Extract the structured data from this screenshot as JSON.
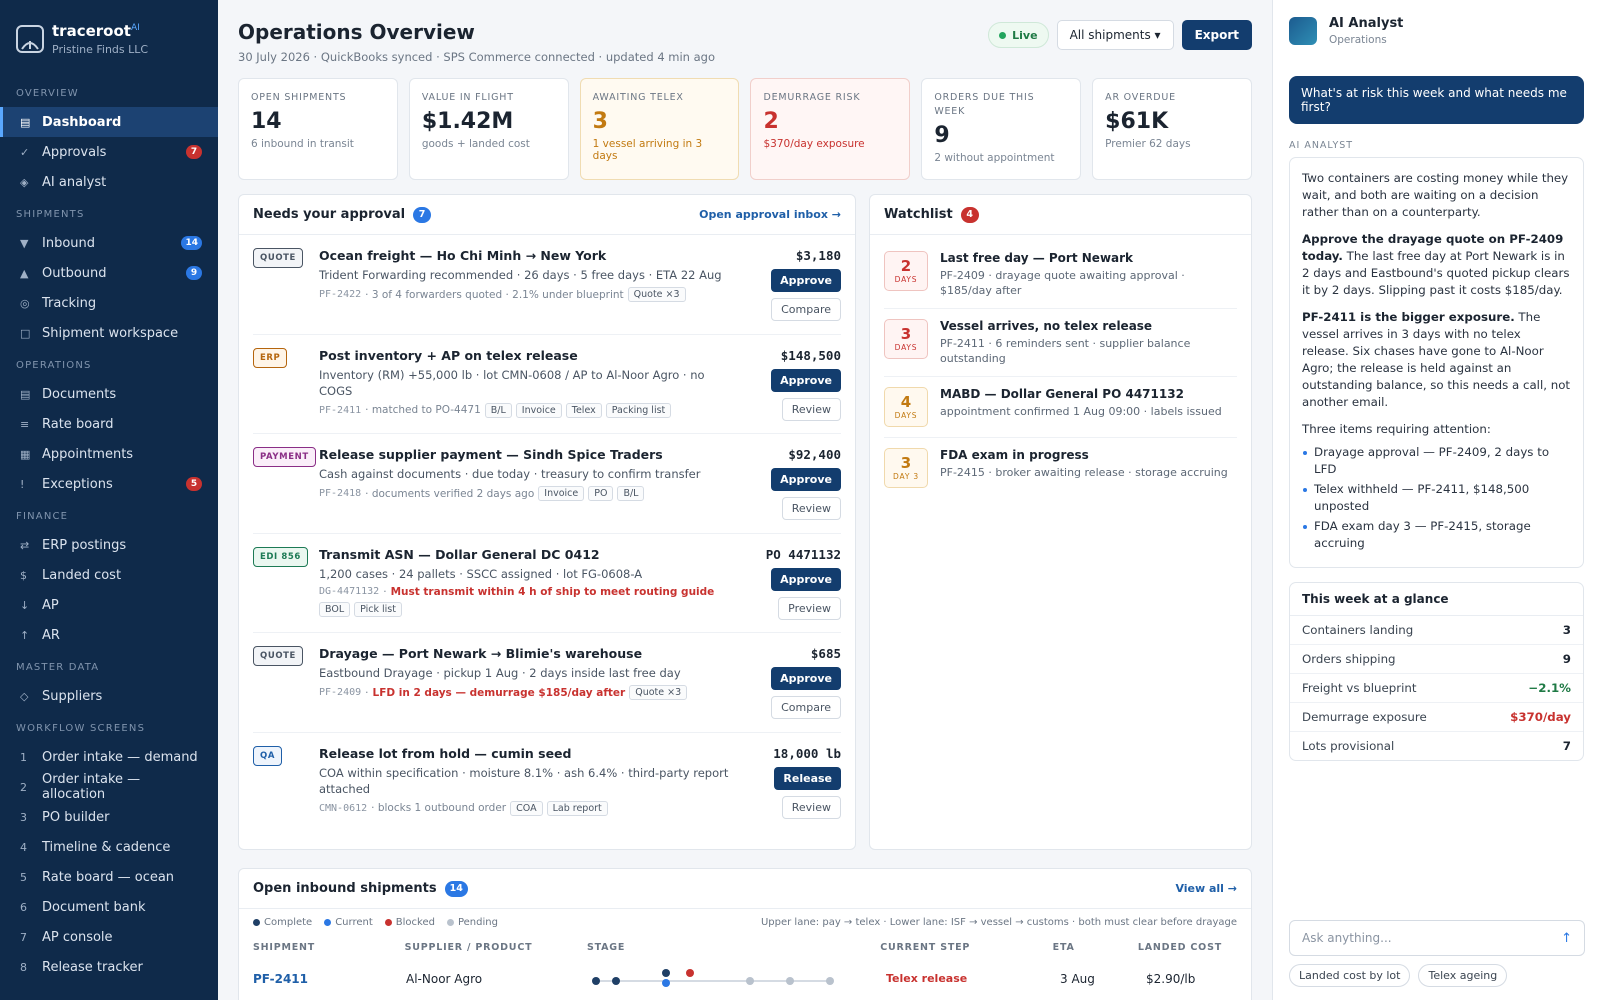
{
  "brand": {
    "name": "traceroot",
    "sup": "AI",
    "company": "Pristine Finds LLC"
  },
  "nav": {
    "overview_title": "OVERVIEW",
    "overview": [
      {
        "label": "Dashboard",
        "icon": "▤",
        "active": true
      },
      {
        "label": "Approvals",
        "icon": "✓",
        "badge": "7",
        "badge_color": "red"
      },
      {
        "label": "AI analyst",
        "icon": "◈"
      }
    ],
    "shipments_title": "SHIPMENTS",
    "shipments": [
      {
        "label": "Inbound",
        "icon": "▼",
        "badge": "14",
        "badge_color": "blue"
      },
      {
        "label": "Outbound",
        "icon": "▲",
        "badge": "9",
        "badge_color": "blue"
      },
      {
        "label": "Tracking",
        "icon": "◎"
      },
      {
        "label": "Shipment workspace",
        "icon": "□"
      }
    ],
    "operations_title": "OPERATIONS",
    "operations": [
      {
        "label": "Documents",
        "icon": "▤"
      },
      {
        "label": "Rate board",
        "icon": "≡"
      },
      {
        "label": "Appointments",
        "icon": "▦"
      },
      {
        "label": "Exceptions",
        "icon": "!",
        "badge": "5",
        "badge_color": "red"
      }
    ],
    "finance_title": "FINANCE",
    "finance": [
      {
        "label": "ERP postings",
        "icon": "⇄"
      },
      {
        "label": "Landed cost",
        "icon": "$"
      },
      {
        "label": "AP",
        "icon": "↓"
      },
      {
        "label": "AR",
        "icon": "↑"
      }
    ],
    "master_title": "MASTER DATA",
    "master": [
      {
        "label": "Suppliers",
        "icon": "◇"
      }
    ],
    "workflow_title": "WORKFLOW SCREENS",
    "workflow": [
      {
        "label": "Order intake — demand",
        "icon": "1"
      },
      {
        "label": "Order intake — allocation",
        "icon": "2"
      },
      {
        "label": "PO builder",
        "icon": "3"
      },
      {
        "label": "Timeline & cadence",
        "icon": "4"
      },
      {
        "label": "Rate board — ocean",
        "icon": "5"
      },
      {
        "label": "Document bank",
        "icon": "6"
      },
      {
        "label": "AP console",
        "icon": "7"
      },
      {
        "label": "Release tracker",
        "icon": "8"
      }
    ]
  },
  "header": {
    "title": "Operations Overview",
    "subtitle": "30 July 2026 · QuickBooks synced · SPS Commerce connected · updated 4 min ago",
    "live": "Live",
    "filter": "All shipments ▾",
    "export": "Export"
  },
  "kpis": [
    {
      "label": "OPEN SHIPMENTS",
      "value": "14",
      "sub": "6 inbound in transit",
      "tone": ""
    },
    {
      "label": "VALUE IN FLIGHT",
      "value": "$1.42M",
      "sub": "goods + landed cost",
      "tone": ""
    },
    {
      "label": "AWAITING TELEX",
      "value": "3",
      "sub": "1 vessel arriving in 3 days",
      "tone": "warn"
    },
    {
      "label": "DEMURRAGE RISK",
      "value": "2",
      "sub": "$370/day exposure",
      "tone": "danger"
    },
    {
      "label": "ORDERS DUE THIS WEEK",
      "value": "9",
      "sub": "2 without appointment",
      "tone": ""
    },
    {
      "label": "AR OVERDUE",
      "value": "$61K",
      "sub": "Premier 62 days",
      "tone": ""
    }
  ],
  "approvals": {
    "title": "Needs your approval",
    "count": "7",
    "link": "Open approval inbox →",
    "items": [
      {
        "tag": "QUOTE",
        "tag_class": "t-quote",
        "title": "Ocean freight — Ho Chi Minh → New York",
        "desc": "Trident Forwarding recommended · 26 days · 5 free days · ETA 22 Aug",
        "ref": "PF-2422",
        "meta": "· 3 of 4 forwarders quoted · 2.1% under blueprint",
        "warn": "",
        "chips": [
          "Quote ×3"
        ],
        "amount": "$3,180",
        "primary": "Approve",
        "secondary": "Compare"
      },
      {
        "tag": "ERP",
        "tag_class": "t-erp",
        "title": "Post inventory + AP on telex release",
        "desc": "Inventory (RM) +55,000 lb · lot CMN-0608 / AP to Al-Noor Agro · no COGS",
        "ref": "PF-2411",
        "meta": "· matched to PO-4471",
        "warn": "",
        "chips": [
          "B/L",
          "Invoice",
          "Telex",
          "Packing list"
        ],
        "amount": "$148,500",
        "primary": "Approve",
        "secondary": "Review"
      },
      {
        "tag": "PAYMENT",
        "tag_class": "t-payment",
        "title": "Release supplier payment — Sindh Spice Traders",
        "desc": "Cash against documents · due today · treasury to confirm transfer",
        "ref": "PF-2418",
        "meta": "· documents verified 2 days ago",
        "warn": "",
        "chips": [
          "Invoice",
          "PO",
          "B/L"
        ],
        "amount": "$92,400",
        "primary": "Approve",
        "secondary": "Review"
      },
      {
        "tag": "EDI 856",
        "tag_class": "t-edi",
        "title": "Transmit ASN — Dollar General DC 0412",
        "desc": "1,200 cases · 24 pallets · SSCC assigned · lot FG-0608-A",
        "ref": "DG-4471132",
        "meta": "·",
        "warn": "Must transmit within 4 h of ship to meet routing guide",
        "chips": [
          "BOL",
          "Pick list"
        ],
        "amount": "PO 4471132",
        "primary": "Approve",
        "secondary": "Preview"
      },
      {
        "tag": "QUOTE",
        "tag_class": "t-quote",
        "title": "Drayage — Port Newark → Blimie's warehouse",
        "desc": "Eastbound Drayage · pickup 1 Aug · 2 days inside last free day",
        "ref": "PF-2409",
        "meta": "·",
        "warn": "LFD in 2 days — demurrage $185/day after",
        "chips": [
          "Quote ×3"
        ],
        "amount": "$685",
        "primary": "Approve",
        "secondary": "Compare"
      },
      {
        "tag": "QA",
        "tag_class": "t-qa",
        "title": "Release lot from hold — cumin seed",
        "desc": "COA within specification · moisture 8.1% · ash 6.4% · third-party report attached",
        "ref": "CMN-0612",
        "meta": "· blocks 1 outbound order",
        "warn": "",
        "chips": [
          "COA",
          "Lab report"
        ],
        "amount": "18,000 lb",
        "primary": "Release",
        "secondary": "Review"
      }
    ]
  },
  "watchlist": {
    "title": "Watchlist",
    "count": "4",
    "items": [
      {
        "num": "2",
        "unit": "DAYS",
        "tone": "d-red",
        "title": "Last free day — Port Newark",
        "desc": "PF-2409 · drayage quote awaiting approval · $185/day after"
      },
      {
        "num": "3",
        "unit": "DAYS",
        "tone": "d-red",
        "title": "Vessel arrives, no telex release",
        "desc": "PF-2411 · 6 reminders sent · supplier balance outstanding"
      },
      {
        "num": "4",
        "unit": "DAYS",
        "tone": "d-amber",
        "title": "MABD — Dollar General PO 4471132",
        "desc": "appointment confirmed 1 Aug 09:00 · labels issued"
      },
      {
        "num": "3",
        "unit": "DAY 3",
        "tone": "d-amber",
        "title": "FDA exam in progress",
        "desc": "PF-2415 · broker awaiting release · storage accruing"
      }
    ]
  },
  "inbound": {
    "title": "Open inbound shipments",
    "count": "14",
    "link": "View all →",
    "legend": [
      "Complete",
      "Current",
      "Blocked",
      "Pending"
    ],
    "legend_colors": [
      "#1f3f66",
      "#2b78e4",
      "#c8322f",
      "#b9c2cd"
    ],
    "note": "Upper lane: pay → telex · Lower lane: ISF → vessel → customs · both must clear before drayage",
    "columns": [
      "SHIPMENT",
      "SUPPLIER / PRODUCT",
      "STAGE",
      "CURRENT STEP",
      "ETA",
      "LANDED COST"
    ],
    "row": {
      "id": "PF-2411",
      "supplier": "Al-Noor Agro",
      "step": "Telex release",
      "eta": "3 Aug",
      "cost": "$2.90/lb"
    }
  },
  "assistant": {
    "name": "AI Analyst",
    "sub": "Operations",
    "question": "What's at risk this week and what needs me first?",
    "label": "AI ANALYST",
    "p1": "Two containers are costing money while they wait, and both are waiting on a decision rather than on a counterparty.",
    "p2_bold": "Approve the drayage quote on PF-2409 today.",
    "p2": " The last free day at Port Newark is in 2 days and Eastbound's quoted pickup clears it by 2 days. Slipping past it costs $185/day.",
    "p3_bold": "PF-2411 is the bigger exposure.",
    "p3": " The vessel arrives in 3 days with no telex release. Six chases have gone to Al-Noor Agro; the release is held against an outstanding balance, so this needs a call, not another email.",
    "p4": "Three items requiring attention:",
    "bullets": [
      "Drayage approval — PF-2409, 2 days to LFD",
      "Telex withheld — PF-2411, $148,500 unposted",
      "FDA exam day 3 — PF-2415, storage accruing"
    ],
    "glance_title": "This week at a glance",
    "glance": [
      {
        "label": "Containers landing",
        "value": "3",
        "tone": ""
      },
      {
        "label": "Orders shipping",
        "value": "9",
        "tone": ""
      },
      {
        "label": "Freight vs blueprint",
        "value": "−2.1%",
        "tone": "green"
      },
      {
        "label": "Demurrage exposure",
        "value": "$370/day",
        "tone": "red"
      },
      {
        "label": "Lots provisional",
        "value": "7",
        "tone": ""
      }
    ],
    "ask_placeholder": "Ask anything...",
    "chips": [
      "Landed cost by lot",
      "Telex ageing"
    ]
  }
}
